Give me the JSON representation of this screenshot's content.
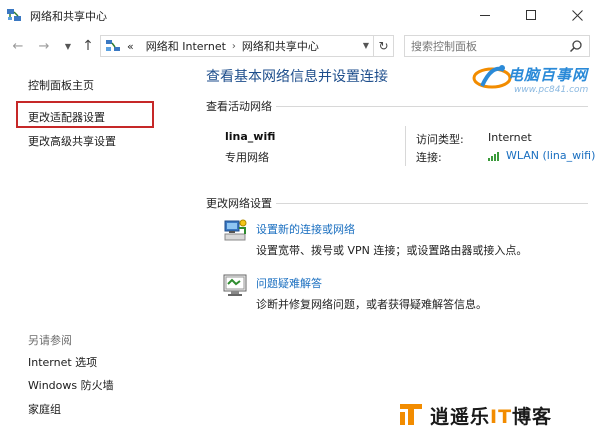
{
  "window": {
    "title": "网络和共享中心"
  },
  "address": {
    "prefix": "«",
    "segments": [
      "网络和 Internet",
      "网络和共享中心"
    ],
    "separator": "›"
  },
  "search": {
    "placeholder": "搜索控制面板"
  },
  "leftnav": {
    "items": [
      "控制面板主页",
      "更改适配器设置",
      "更改高级共享设置"
    ],
    "see_also_title": "另请参阅",
    "see_also": [
      "Internet 选项",
      "Windows 防火墙",
      "家庭组"
    ]
  },
  "main": {
    "title": "查看基本网络信息并设置连接",
    "active_networks_title": "查看活动网络",
    "network": {
      "name": "lina_wifi",
      "type": "专用网络",
      "access_type_label": "访问类型:",
      "access_type_value": "Internet",
      "connection_label": "连接:",
      "connection_value": "WLAN (lina_wifi)"
    },
    "change_settings_title": "更改网络设置",
    "tasks": [
      {
        "link": "设置新的连接或网络",
        "desc": "设置宽带、拨号或 VPN 连接；或设置路由器或接入点。",
        "icon": "network-setup-icon"
      },
      {
        "link": "问题疑难解答",
        "desc": "诊断并修复网络问题，或者获得疑难解答信息。",
        "icon": "troubleshoot-icon"
      }
    ]
  },
  "watermarks": {
    "top_cn": "电脑百事网",
    "top_url": "www.pc841.com",
    "bottom_pre": "逍遥乐",
    "bottom_acc": "IT",
    "bottom_post": "博客"
  },
  "colors": {
    "link": "#1a6fc0",
    "title_blue": "#1e4e8c",
    "highlight": "#c62828",
    "watermark_orange": "#f28c00"
  }
}
